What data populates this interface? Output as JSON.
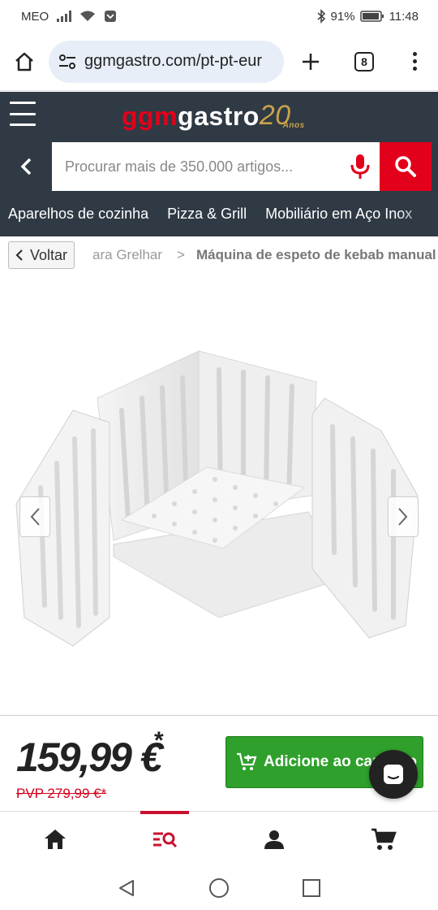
{
  "status_bar": {
    "carrier": "MEO",
    "battery": "91%",
    "time": "11:48",
    "icons": [
      "signal-icon",
      "wifi-icon",
      "notification-icon",
      "bluetooth-icon",
      "battery-icon"
    ]
  },
  "browser": {
    "url": "ggmgastro.com/pt-pt-eur",
    "tab_count": "8",
    "icons": [
      "home-icon",
      "site-settings-icon",
      "new-tab-icon",
      "more-vert-icon"
    ]
  },
  "header": {
    "logo_ggm": "ggm",
    "logo_gastro": "gastro",
    "logo_years": "20",
    "logo_anos": "Anos",
    "search_placeholder": "Procurar mais de 350.000 artigos...",
    "categories": [
      "Aparelhos de cozinha",
      "Pizza & Grill",
      "Mobiliário em Aço Inox"
    ]
  },
  "breadcrumb": {
    "back_label": "Voltar",
    "previous": "ara Grelhar",
    "separator": ">",
    "current": "Máquina de espeto de kebab manual"
  },
  "product": {
    "image_name": "kebab-skewer-machine-image"
  },
  "purchase": {
    "price": "159,99 €",
    "price_marker": "*",
    "rrp": "PVP 279,99 €*",
    "cart_label": "Adicione ao carrinho"
  },
  "bottom_nav": [
    "home-icon",
    "search-list-icon",
    "account-icon",
    "cart-icon"
  ],
  "colors": {
    "brand_red": "#e3001b",
    "header_bg": "#2f3a44",
    "cart_green": "#2ea02b",
    "logo_gold": "#c9a24a"
  }
}
